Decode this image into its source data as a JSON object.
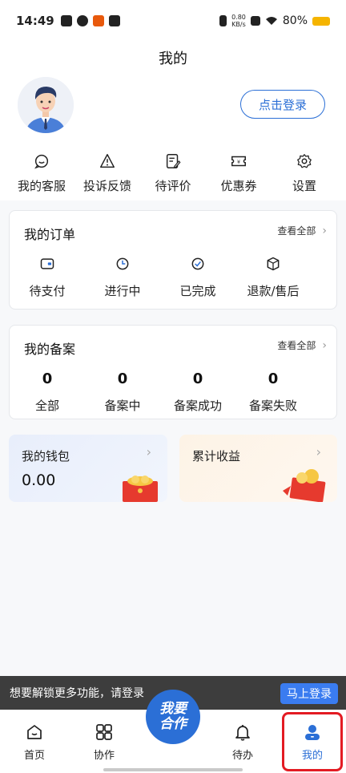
{
  "status": {
    "time": "14:49",
    "speed_top": "0.80",
    "speed_bottom": "KB/s",
    "battery": "80%"
  },
  "header": {
    "title": "我的"
  },
  "profile": {
    "login_label": "点击登录"
  },
  "quick_actions": [
    {
      "label": "我的客服",
      "icon": "smile-chat-icon"
    },
    {
      "label": "投诉反馈",
      "icon": "warning-icon"
    },
    {
      "label": "待评价",
      "icon": "edit-note-icon"
    },
    {
      "label": "优惠券",
      "icon": "coupon-icon"
    },
    {
      "label": "设置",
      "icon": "gear-icon"
    }
  ],
  "orders": {
    "title": "我的订单",
    "more": "查看全部",
    "items": [
      {
        "label": "待支付",
        "icon": "wallet-icon"
      },
      {
        "label": "进行中",
        "icon": "clock-icon"
      },
      {
        "label": "已完成",
        "icon": "check-circle-icon"
      },
      {
        "label": "退款/售后",
        "icon": "box-icon"
      }
    ]
  },
  "filings": {
    "title": "我的备案",
    "more": "查看全部",
    "items": [
      {
        "value": "0",
        "label": "全部"
      },
      {
        "value": "0",
        "label": "备案中"
      },
      {
        "value": "0",
        "label": "备案成功"
      },
      {
        "value": "0",
        "label": "备案失败"
      }
    ]
  },
  "wallet": {
    "title": "我的钱包",
    "value": "0.00"
  },
  "earnings": {
    "title": "累计收益"
  },
  "toast": {
    "message": "想要解锁更多功能，请登录",
    "button": "马上登录"
  },
  "tabbar": {
    "items": [
      {
        "label": "首页",
        "icon": "home-icon"
      },
      {
        "label": "协作",
        "icon": "grid-icon"
      },
      {
        "label": "待办",
        "icon": "bell-icon"
      },
      {
        "label": "我的",
        "icon": "user-icon"
      }
    ],
    "center_line1": "我要",
    "center_line2": "合作"
  },
  "colors": {
    "accent": "#2b6fd6",
    "highlight": "#e31b23",
    "toast_bg": "#3d3d3d"
  }
}
